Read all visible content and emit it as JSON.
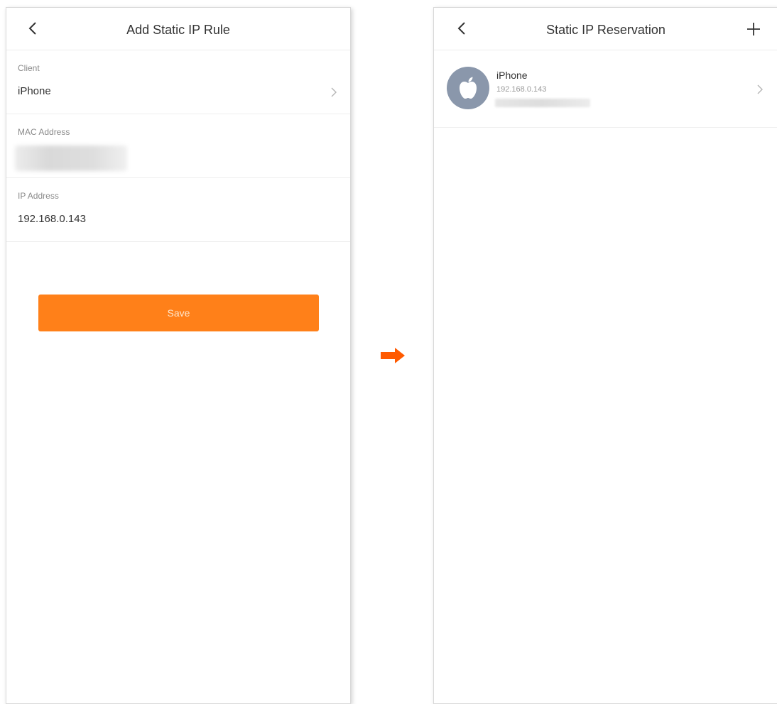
{
  "left_screen": {
    "title": "Add Static IP Rule",
    "client": {
      "label": "Client",
      "value": "iPhone"
    },
    "mac": {
      "label": "MAC Address"
    },
    "ip": {
      "label": "IP Address",
      "value": "192.168.0.143"
    },
    "save_label": "Save"
  },
  "right_screen": {
    "title": "Static IP Reservation",
    "devices": [
      {
        "name": "iPhone",
        "ip": "192.168.0.143",
        "icon": "apple-icon"
      }
    ]
  },
  "colors": {
    "accent": "#ff8019",
    "arrow": "#ff5a00",
    "avatar": "#8a97ab"
  },
  "icons": [
    "back-arrow-icon",
    "chevron-right-icon",
    "plus-icon",
    "apple-icon",
    "right-arrow-icon"
  ]
}
